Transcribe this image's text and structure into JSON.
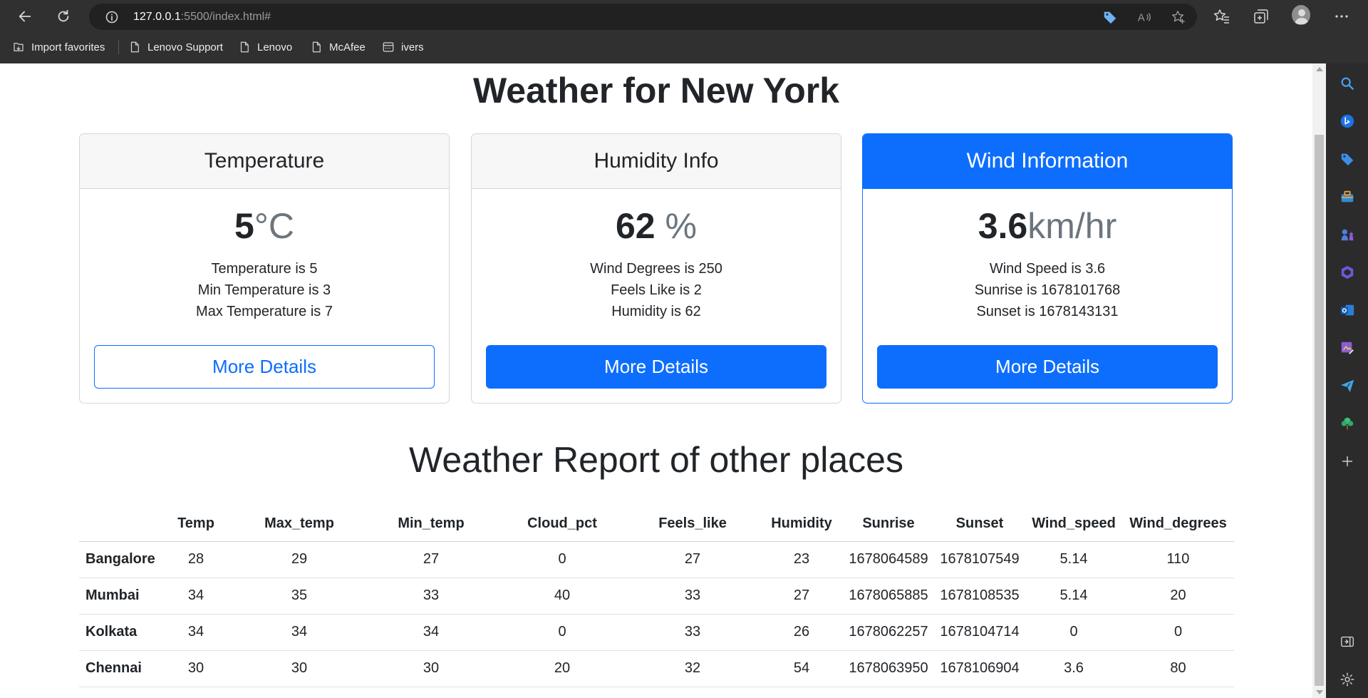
{
  "browser": {
    "url_host": "127.0.0.1",
    "url_rest": ":5500/index.html#",
    "bookmarks": [
      "Import favorites",
      "Lenovo Support",
      "Lenovo",
      "McAfee",
      "ivers"
    ]
  },
  "page": {
    "title": "Weather for New York"
  },
  "cards": {
    "temperature": {
      "header": "Temperature",
      "value": "5",
      "unit": "°C",
      "lines": [
        "Temperature is 5",
        "Min Temperature is 3",
        "Max Temperature is 7"
      ],
      "button": "More Details"
    },
    "humidity": {
      "header": "Humidity Info",
      "value": "62",
      "unit": " %",
      "lines": [
        "Wind Degrees is 250",
        "Feels Like is 2",
        "Humidity is 62"
      ],
      "button": "More Details"
    },
    "wind": {
      "header": "Wind Information",
      "value": "3.6",
      "unit": "km/hr",
      "lines": [
        "Wind Speed is 3.6",
        "Sunrise is 1678101768",
        "Sunset is 1678143131"
      ],
      "button": "More Details"
    }
  },
  "report": {
    "title": "Weather Report of other places",
    "columns": [
      "",
      "Temp",
      "Max_temp",
      "Min_temp",
      "Cloud_pct",
      "Feels_like",
      "Humidity",
      "Sunrise",
      "Sunset",
      "Wind_speed",
      "Wind_degrees"
    ],
    "rows": [
      [
        "Bangalore",
        "28",
        "29",
        "27",
        "0",
        "27",
        "23",
        "1678064589",
        "1678107549",
        "5.14",
        "110"
      ],
      [
        "Mumbai",
        "34",
        "35",
        "33",
        "40",
        "33",
        "27",
        "1678065885",
        "1678108535",
        "5.14",
        "20"
      ],
      [
        "Kolkata",
        "34",
        "34",
        "34",
        "0",
        "33",
        "26",
        "1678062257",
        "1678104714",
        "0",
        "0"
      ],
      [
        "Chennai",
        "30",
        "30",
        "30",
        "20",
        "32",
        "54",
        "1678063950",
        "1678106904",
        "3.6",
        "80"
      ]
    ]
  },
  "colors": {
    "primary": "#0d6efd",
    "chrome_bg": "#303030",
    "sidebar_bg": "#2b2b2b"
  }
}
